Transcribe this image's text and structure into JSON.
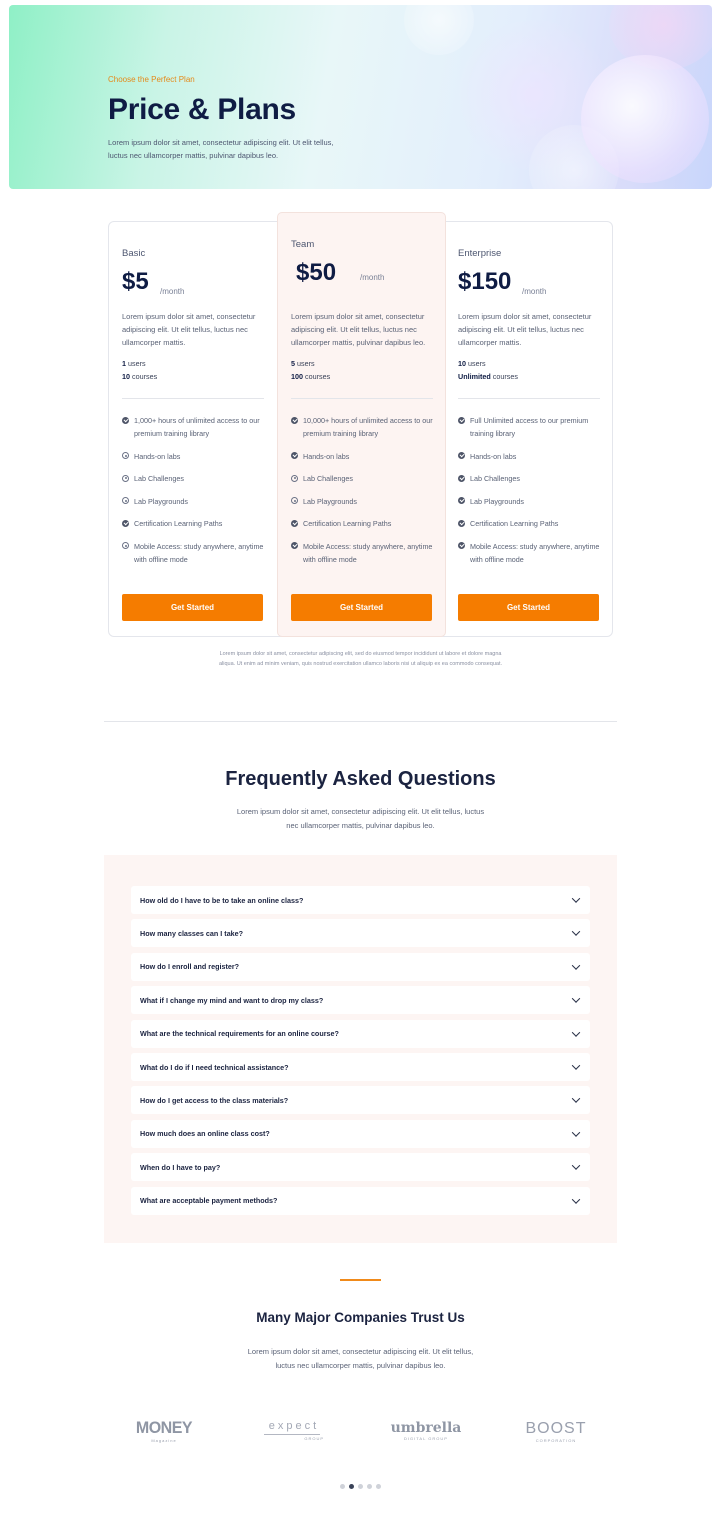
{
  "hero": {
    "eyebrow": "Choose the Perfect Plan",
    "title": "Price & Plans",
    "description": "Lorem ipsum dolor sit amet, consectetur adipiscing elit. Ut elit tellus, luctus nec ullamcorper mattis, pulvinar dapibus leo."
  },
  "plans": [
    {
      "name": "Basic",
      "price": "$5",
      "period": "/month",
      "description": "Lorem ipsum dolor sit amet, consectetur adipiscing elit. Ut elit tellus, luctus nec ullamcorper mattis.",
      "users_value": "1",
      "users_label": " users",
      "courses_value": "10",
      "courses_label": " courses",
      "features": [
        {
          "text": "1,000+ hours of unlimited access to our premium training library",
          "included": true
        },
        {
          "text": "Hands-on labs",
          "included": false
        },
        {
          "text": "Lab Challenges",
          "included": false
        },
        {
          "text": "Lab Playgrounds",
          "included": false
        },
        {
          "text": "Certification Learning Paths",
          "included": true
        },
        {
          "text": "Mobile Access: study anywhere, anytime with offline mode",
          "included": false
        }
      ],
      "button": "Get Started"
    },
    {
      "name": "Team",
      "price": "$50",
      "period": "/month",
      "description": "Lorem ipsum dolor sit amet, consectetur adipiscing elit. Ut elit tellus, luctus nec ullamcorper mattis, pulvinar dapibus leo.",
      "users_value": "5",
      "users_label": " users",
      "courses_value": "100",
      "courses_label": " courses",
      "features": [
        {
          "text": "10,000+ hours of unlimited access to our premium training library",
          "included": true
        },
        {
          "text": "Hands-on labs",
          "included": true
        },
        {
          "text": "Lab Challenges",
          "included": false
        },
        {
          "text": "Lab Playgrounds",
          "included": false
        },
        {
          "text": "Certification Learning Paths",
          "included": true
        },
        {
          "text": "Mobile Access: study anywhere, anytime with offline mode",
          "included": true
        }
      ],
      "button": "Get Started"
    },
    {
      "name": "Enterprise",
      "price": "$150",
      "period": "/month",
      "description": "Lorem ipsum dolor sit amet, consectetur adipiscing elit. Ut elit tellus, luctus nec ullamcorper mattis.",
      "users_value": "10",
      "users_label": " users",
      "courses_value": "Unlimited",
      "courses_label": " courses",
      "features": [
        {
          "text": "Full Unlimited access to our premium training library",
          "included": true
        },
        {
          "text": "Hands-on labs",
          "included": true
        },
        {
          "text": "Lab Challenges",
          "included": true
        },
        {
          "text": "Lab Playgrounds",
          "included": true
        },
        {
          "text": "Certification Learning Paths",
          "included": true
        },
        {
          "text": "Mobile Access: study anywhere, anytime with offline mode",
          "included": true
        }
      ],
      "button": "Get Started"
    }
  ],
  "pricing_note": "Lorem ipsum dolor sit amet, consectetur adipiscing elit, sed do eiusmod tempor incididunt ut labore et dolore magna aliqua. Ut enim ad minim veniam, quis nostrud exercitation ullamco laboris nisi ut aliquip ex ea commodo consequat.",
  "faq": {
    "title": "Frequently Asked Questions",
    "description": "Lorem ipsum dolor sit amet, consectetur adipiscing elit. Ut elit tellus, luctus nec ullamcorper mattis, pulvinar dapibus leo.",
    "questions": [
      "How old do I have to be to take an online class?",
      "How many classes can I take?",
      "How do I enroll and register?",
      "What if I change my mind and want to drop my class?",
      "What are the technical requirements for an online course?",
      "What do I do if I need technical assistance?",
      "How do I get access to the class materials?",
      "How much does an online class cost?",
      "When do I have to pay?",
      "What are acceptable payment methods?"
    ]
  },
  "trust": {
    "title": "Many Major Companies Trust Us",
    "description": "Lorem ipsum dolor sit amet, consectetur adipiscing elit. Ut elit tellus, luctus nec ullamcorper mattis, pulvinar dapibus leo.",
    "logos": [
      {
        "main": "MONEY",
        "sub": "Magazine"
      },
      {
        "main": "expect",
        "sub": "GROUP"
      },
      {
        "main": "umbrella",
        "sub": "DIGITAL GROUP"
      },
      {
        "main": "BOOST",
        "sub": "CORPORATION"
      }
    ],
    "carousel": {
      "pages": 5,
      "active_index": 1
    }
  },
  "colors": {
    "accent": "#f57c00",
    "heading": "#0f1c44",
    "team_highlight": "#fdf4f2",
    "faq_panel": "#fdf5f3"
  }
}
